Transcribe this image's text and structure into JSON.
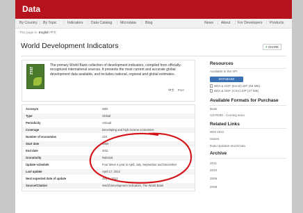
{
  "header": {
    "title": "Data"
  },
  "nav": {
    "left": [
      "By Country",
      "By Topic",
      "Indicators",
      "Data Catalog",
      "Microdata",
      "Blog"
    ],
    "right": [
      "News",
      "About",
      "For Developers",
      "Products"
    ]
  },
  "lang": {
    "prefix": "This page in:",
    "current": "English",
    "alt": "中文"
  },
  "page": {
    "title": "World Development Indicators",
    "share": "SHARE"
  },
  "intro": {
    "cover_year": "2012",
    "text": "The primary World Bank collection of development indicators, compiled from officially-recognized international sources. It presents the most current and accurate global development data available, and includes national, regional and global estimates.",
    "links": [
      "中文",
      "Print"
    ]
  },
  "meta": [
    {
      "k": "Acronym",
      "v": "WDI"
    },
    {
      "k": "Type",
      "v": "Global"
    },
    {
      "k": "Periodicity",
      "v": "Annual"
    },
    {
      "k": "Coverage",
      "v": "Developing and high-income economies"
    },
    {
      "k": "Number of economies",
      "v": "216"
    },
    {
      "k": "Start date",
      "v": "1960"
    },
    {
      "k": "End date",
      "v": "2011"
    },
    {
      "k": "Granularity",
      "v": "National"
    },
    {
      "k": "Update schedule",
      "v": "Four times a year in April, July, September and December"
    },
    {
      "k": "Last update",
      "v": "April 17, 2012"
    },
    {
      "k": "Next expected date of update",
      "v": "July 1, 2012"
    },
    {
      "k": "Source/Citation",
      "v": "World Development Indicators, The World Bank"
    }
  ],
  "sidebar": {
    "resources_title": "Resources",
    "api_text": "Available in the API",
    "database_button": "DATABASE",
    "downloads": [
      "WDI & GDF (Excel)-ZIP (68 MB)",
      "WDI & GDF (CSV)-ZIP (37 MB)"
    ],
    "avail_title": "Available Formats for Purchase",
    "book": "Book",
    "cdrom": "CD-ROM - Coming soon",
    "related_title": "Related Links",
    "related": [
      "WDI 2012",
      "Issues",
      "Data Updates and Errata"
    ],
    "archive_title": "Archive",
    "archive": [
      "2011",
      "2010",
      "2009",
      "2008"
    ]
  },
  "annotation_color": "#d4141b"
}
